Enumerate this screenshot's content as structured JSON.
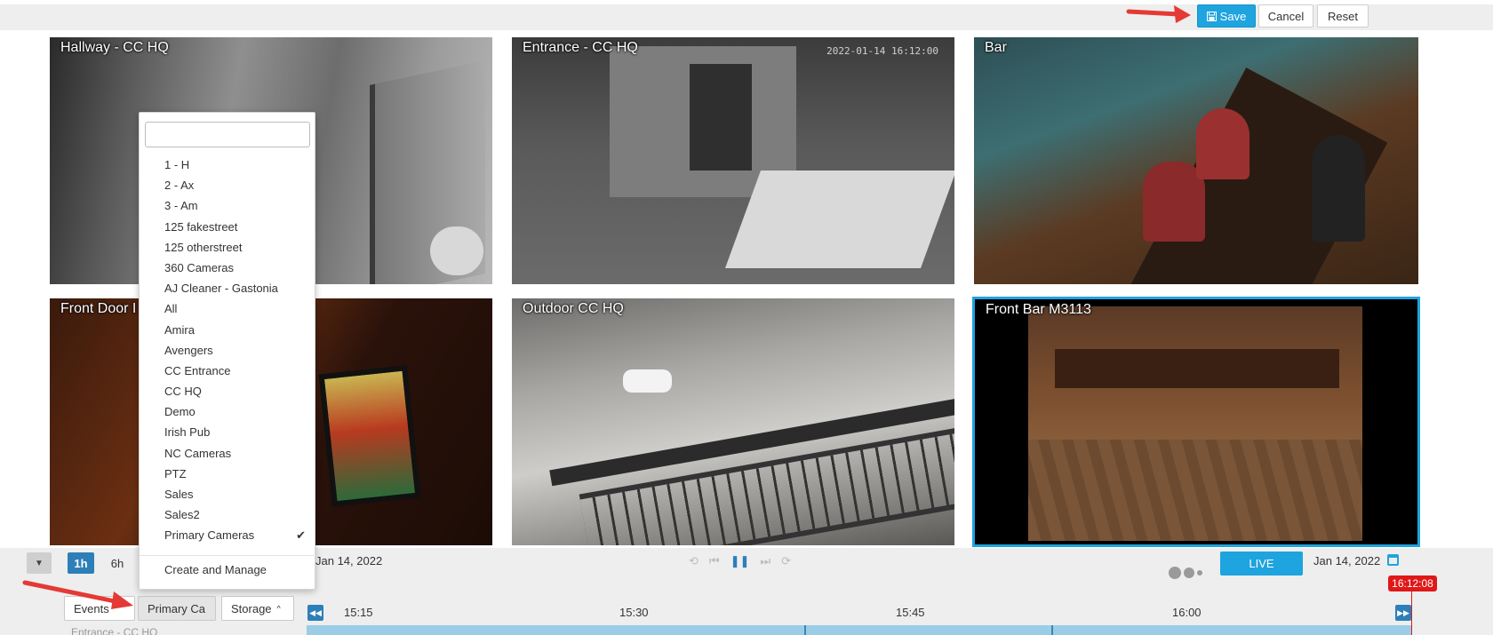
{
  "toolbar": {
    "save_label": "Save",
    "cancel_label": "Cancel",
    "reset_label": "Reset"
  },
  "cameras": [
    {
      "name": "Hallway - CC HQ",
      "timestamp": ""
    },
    {
      "name": "Entrance - CC HQ",
      "timestamp": "2022-01-14 16:12:00"
    },
    {
      "name": "Bar",
      "timestamp": ""
    },
    {
      "name": "Front Door I",
      "timestamp": ""
    },
    {
      "name": "Outdoor CC HQ",
      "timestamp": ""
    },
    {
      "name": "Front Bar M3113",
      "timestamp": ""
    }
  ],
  "dropdown": {
    "search_value": "",
    "items": [
      {
        "label": "1 - H",
        "checked": false
      },
      {
        "label": "2 - Ax",
        "checked": false
      },
      {
        "label": "3 - Am",
        "checked": false
      },
      {
        "label": "125 fakestreet",
        "checked": false
      },
      {
        "label": "125 otherstreet",
        "checked": false
      },
      {
        "label": "360 Cameras",
        "checked": false
      },
      {
        "label": "AJ Cleaner - Gastonia",
        "checked": false
      },
      {
        "label": "All",
        "checked": false
      },
      {
        "label": "Amira",
        "checked": false
      },
      {
        "label": "Avengers",
        "checked": false
      },
      {
        "label": "CC Entrance",
        "checked": false
      },
      {
        "label": "CC HQ",
        "checked": false
      },
      {
        "label": "Demo",
        "checked": false
      },
      {
        "label": "Irish Pub",
        "checked": false
      },
      {
        "label": "NC Cameras",
        "checked": false
      },
      {
        "label": "PTZ",
        "checked": false
      },
      {
        "label": "Sales",
        "checked": false
      },
      {
        "label": "Sales2",
        "checked": false
      },
      {
        "label": "Primary Cameras",
        "checked": true
      }
    ],
    "check_glyph": "✔",
    "manage_label": "Create and Manage"
  },
  "timeline": {
    "ranges": [
      "1h",
      "6h"
    ],
    "active_range": "1h",
    "date_left": "Jan 14, 2022",
    "live_label": "LIVE",
    "date_right": "Jan 14, 2022",
    "now_time": "16:12:08",
    "ticks": [
      "15:15",
      "15:30",
      "15:45",
      "16:00"
    ],
    "tabs": {
      "events": "Events",
      "primary": "Primary Ca",
      "storage": "Storage"
    },
    "row_label": "Entrance - CC HQ"
  },
  "colors": {
    "accent": "#1ea4de",
    "active_range": "#2d7fb8",
    "now_marker": "#e01818",
    "annotation_arrow": "#e53935"
  }
}
